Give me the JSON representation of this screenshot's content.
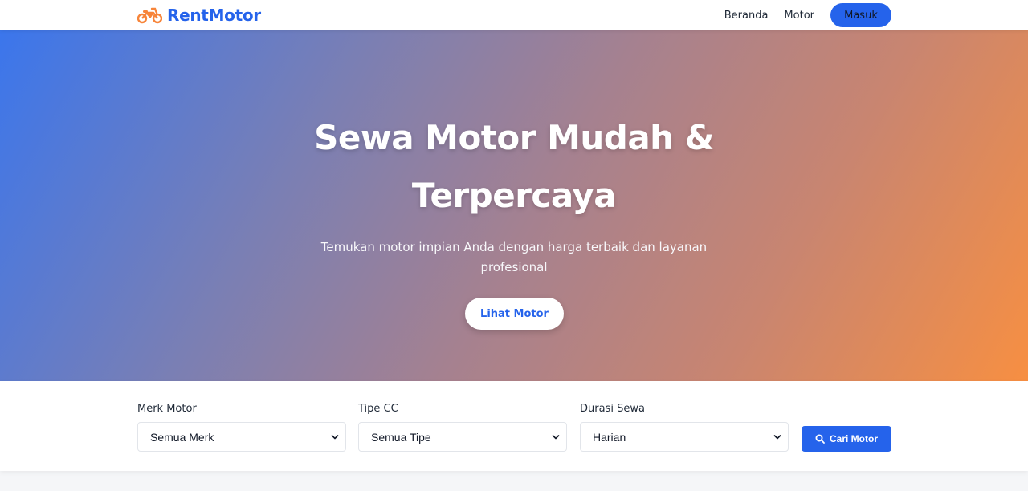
{
  "navbar": {
    "brand": "RentMotor",
    "brand_icon": "motorcycle-icon",
    "links": [
      "Beranda",
      "Motor"
    ],
    "login_label": "Masuk"
  },
  "hero": {
    "title": "Sewa Motor Mudah & Terpercaya",
    "subtitle": "Temukan motor impian Anda dengan harga terbaik dan layanan profesional",
    "cta_label": "Lihat Motor"
  },
  "search": {
    "fields": [
      {
        "label": "Merk Motor",
        "selected": "Semua Merk"
      },
      {
        "label": "Tipe CC",
        "selected": "Semua Tipe"
      },
      {
        "label": "Durasi Sewa",
        "selected": "Harian"
      }
    ],
    "button_label": "Cari Motor",
    "button_icon": "search-icon"
  },
  "colors": {
    "primary": "#2563eb",
    "accent_orange": "#f7853a",
    "gradient_start": "#3b76ec",
    "gradient_end": "#f78f42"
  }
}
